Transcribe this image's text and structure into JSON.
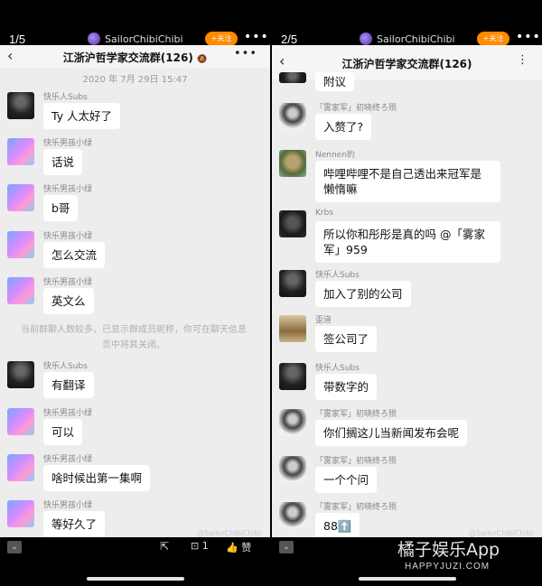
{
  "author": {
    "name": "SailorChibiChibi",
    "follow_label": "+关注",
    "more": "•••"
  },
  "chat": {
    "title": "江浙沪哲学家交流群(126)",
    "mute_icon": "mute-bell"
  },
  "left": {
    "pager": "1/5",
    "timestamp": "2020 年 7月 29日 15:47",
    "notice": "当前群聊人数较多，已显示群成员昵称，你可在聊天信息页中将其关闭。",
    "messages": [
      {
        "sender": "快乐人Subs",
        "text": "Ty 人太好了"
      },
      {
        "sender": "快乐男孩小绿",
        "text": "话说"
      },
      {
        "sender": "快乐男孩小绿",
        "text": "b哥"
      },
      {
        "sender": "快乐男孩小绿",
        "text": "怎么交流"
      },
      {
        "sender": "快乐男孩小绿",
        "text": "英文么"
      },
      {
        "sender": "快乐人Subs",
        "text": "有翻译"
      },
      {
        "sender": "快乐男孩小绿",
        "text": "可以"
      },
      {
        "sender": "快乐男孩小绿",
        "text": "啥时候出第一集啊"
      },
      {
        "sender": "快乐男孩小绿",
        "text": "等好久了"
      }
    ],
    "watermark": "@SailorChibiChibi"
  },
  "right": {
    "pager": "2/5",
    "partial_text": "附议",
    "messages": [
      {
        "sender": "「雾家军」初晓终ろ殒",
        "text": "入赘了?"
      },
      {
        "sender": "Nennen豹",
        "text": "哔哩哔哩不是自己透出来冠军是懒惰嘛"
      },
      {
        "sender": "Krbs",
        "text": "所以你和彤彤是真的吗 @「雾家军」959"
      },
      {
        "sender": "快乐人Subs",
        "text": "加入了别的公司"
      },
      {
        "sender": "歪道",
        "text": "签公司了"
      },
      {
        "sender": "快乐人Subs",
        "text": "带数字的"
      },
      {
        "sender": "「雾家军」初晓终ろ殒",
        "text": "你们搁这儿当新闻发布会呢"
      },
      {
        "sender": "「雾家军」初晓终ろ殒",
        "text": "一个个问"
      },
      {
        "sender": "「雾家军」初晓终ろ殒",
        "text": "88⬆️"
      }
    ],
    "watermark": "@SailorChibiChibi"
  },
  "bottom": {
    "comment_count": "1",
    "like_label": "赞"
  },
  "site_watermark": {
    "brand": "橘子娱乐App",
    "url": "HAPPYJUZI.COM"
  }
}
